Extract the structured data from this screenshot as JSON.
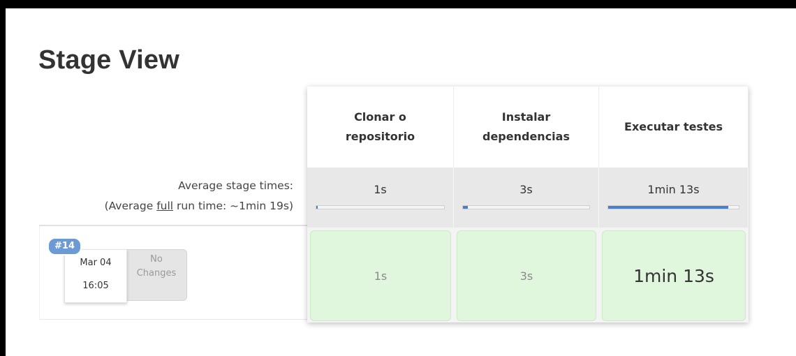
{
  "page_title": "Stage View",
  "summary": {
    "avg_label": "Average stage times:",
    "full_prefix": "(Average ",
    "full_word": "full",
    "full_suffix": " run time: ~1min 19s)"
  },
  "run": {
    "badge": "#14",
    "date": "Mar 04",
    "time": "16:05",
    "changes_line1": "No",
    "changes_line2": "Changes"
  },
  "stages": [
    {
      "name_line1": "Clonar o",
      "name_line2": "repositorio",
      "avg_time": "1s",
      "avg_fraction": 0.01,
      "run_time": "1s"
    },
    {
      "name_line1": "Instalar",
      "name_line2": "dependencias",
      "avg_time": "3s",
      "avg_fraction": 0.04,
      "run_time": "3s"
    },
    {
      "name_line1": "Executar testes",
      "name_line2": "",
      "avg_time": "1min 13s",
      "avg_fraction": 0.92,
      "run_time": "1min 13s"
    }
  ],
  "colors": {
    "progress_fill": "#4a7fd0",
    "success_cell": "#e0f7de",
    "badge": "#6b9ad4"
  }
}
